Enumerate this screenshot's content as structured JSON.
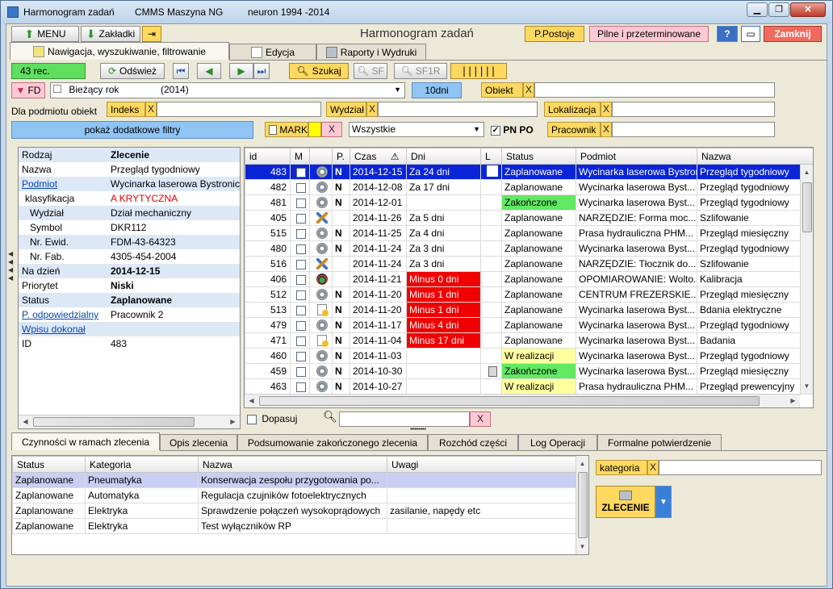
{
  "window": {
    "app_title": "Harmonogram zadań",
    "product": "CMMS Maszyna NG",
    "vendor": "neuron 1994 -2014",
    "min": "▁",
    "max": "❐",
    "close": "✕"
  },
  "toolbar": {
    "menu": "MENU",
    "bookmarks": "Zakładki",
    "heading": "Harmonogram zadań",
    "ppostoje": "P.Postoje",
    "urgent": "Pilne i przeterminowane",
    "help": "?",
    "close": "Zamknij"
  },
  "tabs": {
    "nav": "Nawigacja, wyszukiwanie, filtrowanie",
    "edit": "Edycja",
    "reports": "Raporty i Wydruki"
  },
  "nav": {
    "records": "43 rec.",
    "refresh": "Odśwież",
    "search": "Szukaj",
    "sf": "SF",
    "sf1r": "SF1R",
    "fd": "FD",
    "period": "Bieżący rok",
    "year": "(2014)",
    "days": "10dni",
    "obiekt": "Obiekt",
    "x": "X",
    "for_object": "Dla podmiotu obiekt",
    "indeks": "Indeks",
    "wydzial": "Wydział",
    "lokalizacja": "Lokalizacja",
    "more_filters": "pokaż dodatkowe filtry",
    "mark": "MARK",
    "all": "Wszystkie",
    "pnpo": "PN PO",
    "pracownik": "Pracownik"
  },
  "details": {
    "header_key": "Rodzaj",
    "header_val": "Zlecenie",
    "rows": [
      {
        "k": "Nazwa",
        "v": "Przegląd tygodniowy"
      },
      {
        "k": "Podmiot",
        "v": "Wycinarka laserowa Bystronic"
      },
      {
        "k": "klasyfikacja",
        "v": "A  KRYTYCZNA"
      },
      {
        "k": "Wydział",
        "v": "Dział mechaniczny"
      },
      {
        "k": "Symbol",
        "v": "DKR112"
      },
      {
        "k": "Nr. Ewid.",
        "v": "FDM-43-64323"
      },
      {
        "k": "Nr. Fab.",
        "v": "4305-454-2004"
      },
      {
        "k": "Na dzień",
        "v": "2014-12-15"
      },
      {
        "k": "Priorytet",
        "v": "Niski"
      },
      {
        "k": "Status",
        "v": "Zaplanowane"
      },
      {
        "k": "P. odpowiedzialny",
        "v": "Pracownik 2"
      },
      {
        "k": "Wpisu dokonał",
        "v": ""
      },
      {
        "k": "ID",
        "v": "483"
      }
    ]
  },
  "grid": {
    "columns": [
      "id",
      "M",
      "",
      "P.",
      "Czas",
      "Dni",
      "L",
      "Status",
      "Podmiot",
      "Nazwa"
    ],
    "rows": [
      {
        "id": "483",
        "icon": "gear",
        "p": "N",
        "czas": "2014-12-15",
        "dni": "Za 24 dni",
        "status": "Zaplanowane",
        "podmiot": "Wycinarka laserowa Bystronic",
        "nazwa": "Przegląd tygodniowy",
        "sel": true
      },
      {
        "id": "482",
        "icon": "gear",
        "p": "N",
        "czas": "2014-12-08",
        "dni": "Za 17 dni",
        "status": "Zaplanowane",
        "podmiot": "Wycinarka laserowa Byst...",
        "nazwa": "Przegląd tygodniowy"
      },
      {
        "id": "481",
        "icon": "gear",
        "p": "N",
        "czas": "2014-12-01",
        "dni": "",
        "status": "Zakończone",
        "st": "green",
        "podmiot": "Wycinarka laserowa Byst...",
        "nazwa": "Przegląd tygodniowy"
      },
      {
        "id": "405",
        "icon": "tool",
        "p": "",
        "czas": "2014-11-26",
        "dni": "Za 5 dni",
        "status": "Zaplanowane",
        "podmiot": "NARZĘDZIE: Forma moc...",
        "nazwa": "Szlifowanie"
      },
      {
        "id": "515",
        "icon": "gear",
        "p": "N",
        "czas": "2014-11-25",
        "dni": "Za 4 dni",
        "status": "Zaplanowane",
        "podmiot": "Prasa hydrauliczna PHM...",
        "nazwa": "Przegląd miesięczny"
      },
      {
        "id": "480",
        "icon": "gear",
        "p": "N",
        "czas": "2014-11-24",
        "dni": "Za 3 dni",
        "status": "Zaplanowane",
        "podmiot": "Wycinarka laserowa Byst...",
        "nazwa": "Przegląd tygodniowy"
      },
      {
        "id": "516",
        "icon": "tool",
        "p": "",
        "czas": "2014-11-24",
        "dni": "Za 3 dni",
        "status": "Zaplanowane",
        "podmiot": "NARZĘDZIE: Tłocznik do...",
        "nazwa": "Szlifowanie"
      },
      {
        "id": "406",
        "icon": "meter",
        "p": "",
        "czas": "2014-11-21",
        "dni": "Minus 0 dni",
        "red": true,
        "status": "Zaplanowane",
        "podmiot": "OPOMIAROWANIE: Wolto...",
        "nazwa": "Kalibracja"
      },
      {
        "id": "512",
        "icon": "gear",
        "p": "N",
        "czas": "2014-11-20",
        "dni": "Minus 1 dni",
        "red": true,
        "status": "Zaplanowane",
        "podmiot": "CENTRUM FREZERSKIE...",
        "nazwa": "Przegląd miesięczny"
      },
      {
        "id": "513",
        "icon": "doc",
        "p": "N",
        "czas": "2014-11-20",
        "dni": "Minus 1 dni",
        "red": true,
        "status": "Zaplanowane",
        "podmiot": "Wycinarka laserowa Byst...",
        "nazwa": "Bdania elektryczne"
      },
      {
        "id": "479",
        "icon": "gear",
        "p": "N",
        "czas": "2014-11-17",
        "dni": "Minus 4 dni",
        "red": true,
        "status": "Zaplanowane",
        "podmiot": "Wycinarka laserowa Byst...",
        "nazwa": "Przegląd tygodniowy"
      },
      {
        "id": "471",
        "icon": "doc",
        "p": "N",
        "czas": "2014-11-04",
        "dni": "Minus 17 dni",
        "red": true,
        "status": "Zaplanowane",
        "podmiot": "Wycinarka laserowa Byst...",
        "nazwa": "Badania"
      },
      {
        "id": "460",
        "icon": "gear",
        "p": "N",
        "czas": "2014-11-03",
        "dni": "",
        "status": "W realizacji",
        "st": "yellow",
        "podmiot": "Wycinarka laserowa Byst...",
        "nazwa": "Przegląd tygodniowy"
      },
      {
        "id": "459",
        "icon": "gear",
        "p": "N",
        "czas": "2014-10-30",
        "dni": "",
        "calc": true,
        "status": "Zakończone",
        "st": "green",
        "podmiot": "Wycinarka laserowa Byst...",
        "nazwa": "Przegląd miesięczny"
      },
      {
        "id": "463",
        "icon": "gear",
        "p": "N",
        "czas": "2014-10-27",
        "dni": "",
        "status": "W realizacji",
        "st": "yellow",
        "podmiot": "Prasa hydrauliczna PHM...",
        "nazwa": "Przegląd prewencyjny"
      }
    ],
    "fit": "Dopasuj",
    "x": "X"
  },
  "bottom_tabs": [
    "Czynności w ramach zlecenia",
    "Opis zlecenia",
    "Podsumowanie zakończonego zlecenia",
    "Rozchód części",
    "Log Operacji",
    "Formalne potwierdzenie"
  ],
  "activities": {
    "columns": [
      "Status",
      "Kategoria",
      "Nazwa",
      "Uwagi"
    ],
    "rows": [
      {
        "status": "Zaplanowane",
        "kat": "Pneumatyka",
        "nazwa": "Konserwacja zespołu przygotowania po...",
        "uwagi": ""
      },
      {
        "status": "Zaplanowane",
        "kat": "Automatyka",
        "nazwa": "Regulacja czujników fotoelektrycznych",
        "uwagi": ""
      },
      {
        "status": "Zaplanowane",
        "kat": "Elektryka",
        "nazwa": "Sprawdzenie połączeń wysokoprądowych",
        "uwagi": "zasilanie, napędy etc"
      },
      {
        "status": "Zaplanowane",
        "kat": "Elektryka",
        "nazwa": "Test wyłączników RP",
        "uwagi": ""
      }
    ]
  },
  "side": {
    "kategoria": "kategoria",
    "x": "X",
    "zlecenie": "ZLECENIE"
  },
  "colors": {
    "accent": "#0a24d8",
    "done": "#62e862",
    "in_progress": "#ffffa0",
    "overdue": "#f00000",
    "chip": "#ffd860"
  }
}
